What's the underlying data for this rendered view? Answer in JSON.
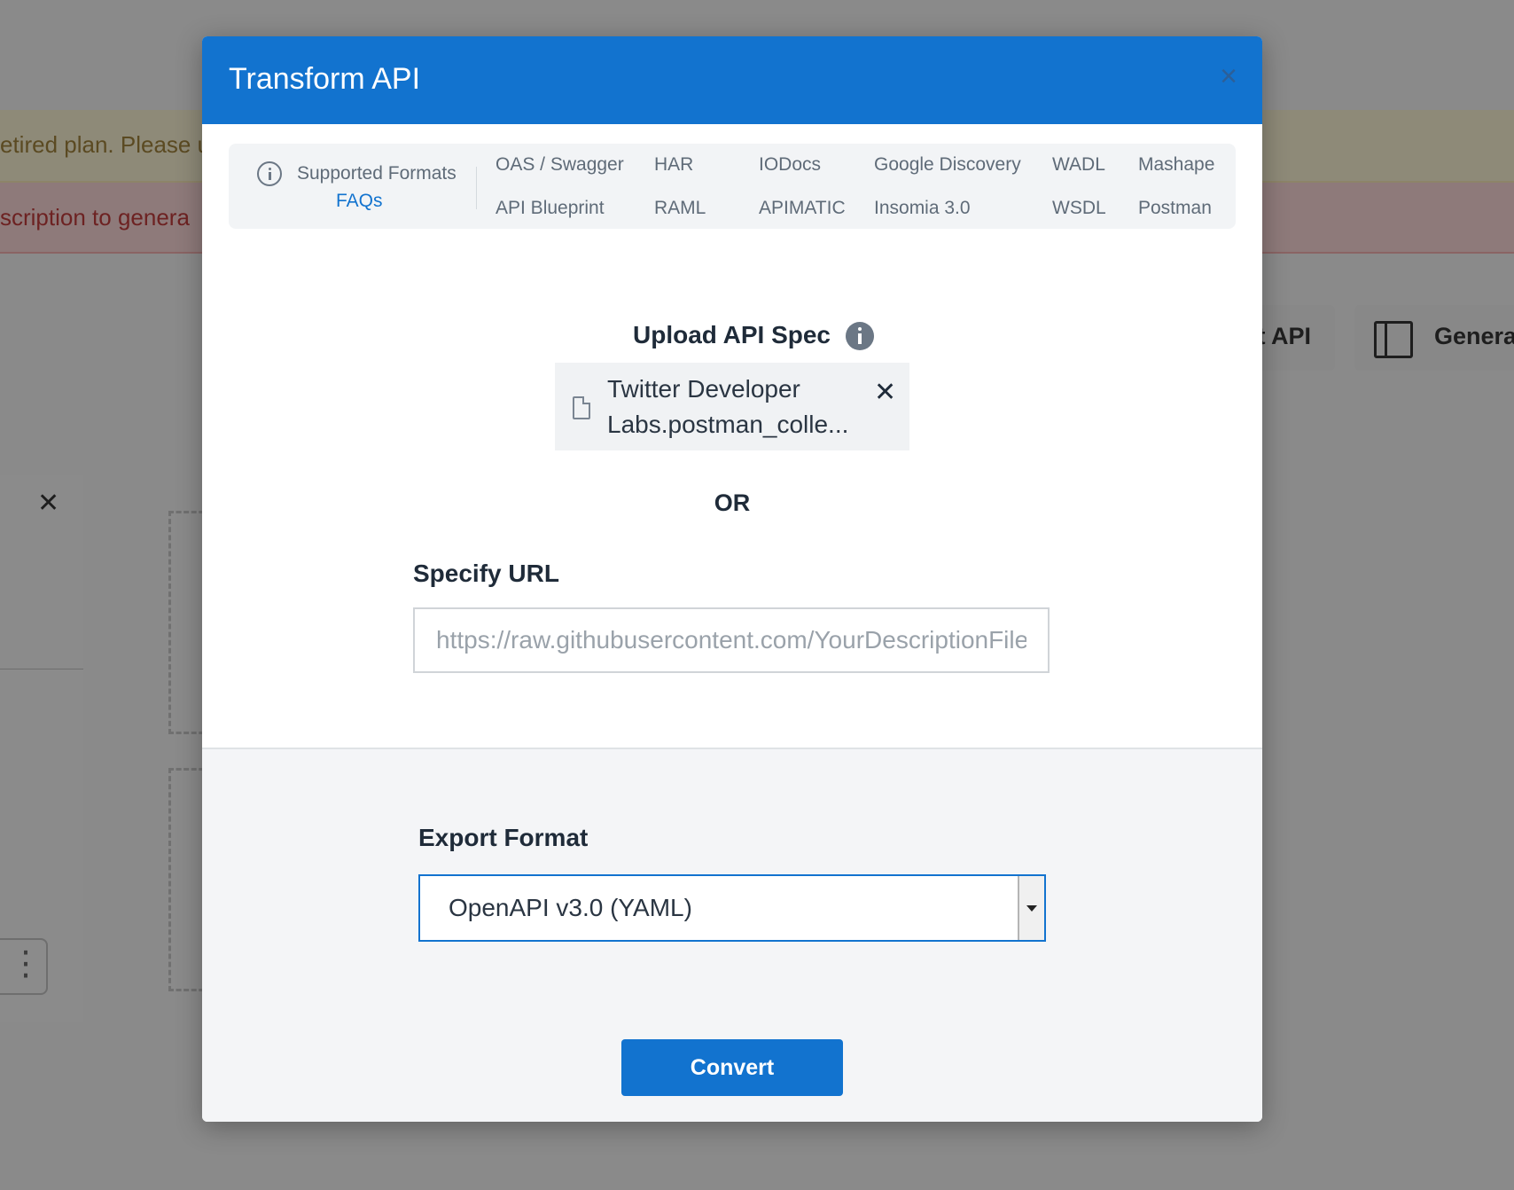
{
  "background": {
    "warning_text": "etired plan. Please u",
    "error_text": "scription to genera",
    "buttons": [
      {
        "label": "rt API"
      },
      {
        "label": "Genera"
      }
    ]
  },
  "modal": {
    "title": "Transform API",
    "close_icon": "×",
    "supported_formats": {
      "label": "Supported Formats",
      "faqs_link": "FAQs",
      "formats_row1": [
        "OAS / Swagger",
        "HAR",
        "IODocs",
        "Google Discovery",
        "WADL",
        "Mashape"
      ],
      "formats_row2": [
        "API Blueprint",
        "RAML",
        "APIMATIC",
        "Insomia 3.0",
        "WSDL",
        "Postman"
      ]
    },
    "upload": {
      "title": "Upload API Spec",
      "file_name_line1": "Twitter Developer",
      "file_name_line2": "Labs.postman_colle...",
      "remove_icon": "✕"
    },
    "or_text": "OR",
    "url": {
      "label": "Specify URL",
      "placeholder": "https://raw.githubusercontent.com/YourDescriptionFile",
      "value": ""
    },
    "export": {
      "label": "Export Format",
      "selected": "OpenAPI v3.0 (YAML)"
    },
    "convert_button": "Convert",
    "colors": {
      "primary": "#1273cf",
      "header_text": "#ffffff",
      "heading_text": "#1f2b39",
      "muted_text": "#5f6b78"
    }
  }
}
